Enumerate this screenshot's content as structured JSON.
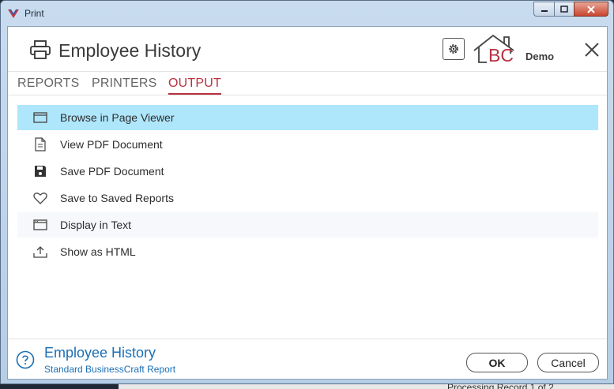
{
  "window": {
    "title": "Print"
  },
  "header": {
    "title": "Employee History",
    "logo_text": "BC",
    "demo_label": "Demo"
  },
  "tabs": [
    {
      "label": "REPORTS",
      "active": false
    },
    {
      "label": "PRINTERS",
      "active": false
    },
    {
      "label": "OUTPUT",
      "active": true
    }
  ],
  "output_options": [
    {
      "label": "Browse in Page Viewer",
      "icon": "browser-window-icon",
      "selected": true
    },
    {
      "label": "View PDF Document",
      "icon": "document-icon",
      "selected": false
    },
    {
      "label": "Save PDF Document",
      "icon": "floppy-disk-icon",
      "selected": false
    },
    {
      "label": "Save to Saved Reports",
      "icon": "heart-icon",
      "selected": false
    },
    {
      "label": "Display in Text",
      "icon": "text-window-icon",
      "selected": false
    },
    {
      "label": "Show as HTML",
      "icon": "export-tray-icon",
      "selected": false
    }
  ],
  "footer": {
    "report_title": "Employee History",
    "report_subtitle": "Standard BusinessCraft Report",
    "ok_label": "OK",
    "cancel_label": "Cancel"
  },
  "background": {
    "partial_text": "Processing Record 1 of 2"
  },
  "colors": {
    "accent_red": "#b83241",
    "selected_row": "#aee6fb",
    "link_blue": "#1a6fb5"
  }
}
